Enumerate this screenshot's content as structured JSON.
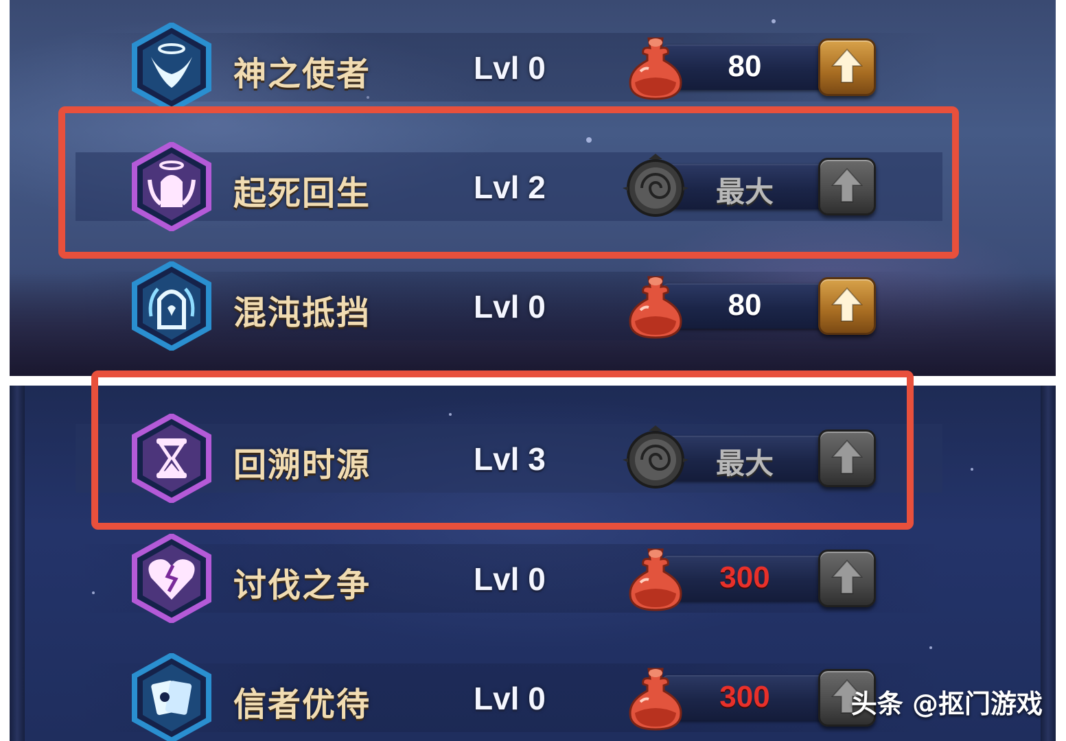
{
  "skills": [
    {
      "name": "神之使者",
      "level": "Lvl 0",
      "cost": "80",
      "cost_state": "normal",
      "cost_icon": "red-potion-icon",
      "upgrade": "gold",
      "icon": "angel-wings-icon",
      "frame": "blue"
    },
    {
      "name": "起死回生",
      "level": "Lvl 2",
      "cost": "最大",
      "cost_state": "max",
      "cost_icon": "dark-swirl-medal-icon",
      "upgrade": "gray",
      "icon": "revive-door-icon",
      "frame": "purple"
    },
    {
      "name": "混沌抵挡",
      "level": "Lvl 0",
      "cost": "80",
      "cost_state": "normal",
      "cost_icon": "red-potion-icon",
      "upgrade": "gold",
      "icon": "chaos-shield-door-icon",
      "frame": "blue"
    },
    {
      "name": "回溯时源",
      "level": "Lvl 3",
      "cost": "最大",
      "cost_state": "max",
      "cost_icon": "dark-swirl-medal-icon",
      "upgrade": "gray",
      "icon": "hourglass-icon",
      "frame": "purple"
    },
    {
      "name": "讨伐之争",
      "level": "Lvl 0",
      "cost": "300",
      "cost_state": "unaffordable",
      "cost_icon": "red-potion-icon",
      "upgrade": "gray",
      "icon": "broken-heart-icon",
      "frame": "purple"
    },
    {
      "name": "信者优待",
      "level": "Lvl 0",
      "cost": "300",
      "cost_state": "unaffordable",
      "cost_icon": "red-potion-icon",
      "upgrade": "gray",
      "icon": "cards-icon",
      "frame": "blue"
    }
  ],
  "watermark": "头条 @抠门游戏",
  "colors": {
    "highlight_border": "#e8503c",
    "name_text": "#f1dcb2",
    "unaffordable_cost": "#e8302a",
    "blue_frame": "#2a8fd0",
    "purple_frame": "#b45ad8"
  }
}
